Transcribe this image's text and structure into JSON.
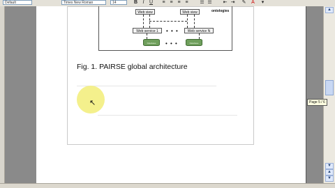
{
  "toolbar": {
    "style_value": "Default",
    "font_value": "Times New Roman",
    "size_value": "14",
    "bold_label": "B",
    "italic_label": "I",
    "underline_label": "U"
  },
  "figure": {
    "node_top_left": "Web view",
    "node_top_right": "Web view",
    "ontologies_label": "ontologies",
    "service_1_label": "Web service 1",
    "service_n_label": "Web service N",
    "ellipsis_mid": "• • •",
    "ellipsis_bottom": "• • •",
    "db_left_label": "Database",
    "db_right_label": "Database",
    "caption": "Fig. 1.  PAIRSE global architecture"
  },
  "status": {
    "page_tooltip": "Page 5 / 6"
  }
}
